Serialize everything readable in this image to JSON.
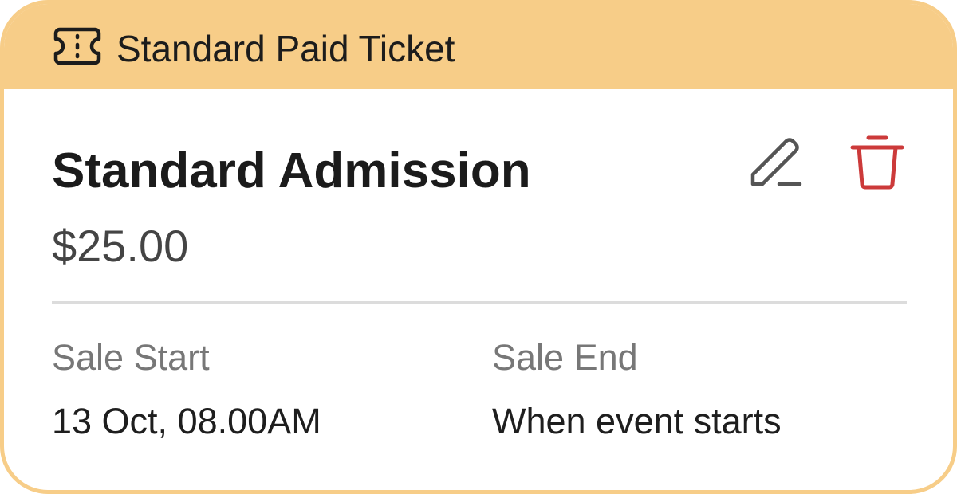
{
  "header": {
    "icon": "ticket-icon",
    "title": "Standard Paid Ticket"
  },
  "ticket": {
    "name": "Standard Admission",
    "price": "$25.00"
  },
  "actions": {
    "edit_icon": "pencil-icon",
    "delete_icon": "trash-icon"
  },
  "sale": {
    "start_label": "Sale Start",
    "start_value": "13 Oct, 08.00AM",
    "end_label": "Sale End",
    "end_value": "When event starts"
  },
  "colors": {
    "header_background": "#f7cd88",
    "delete_accent": "#cc3a3a",
    "edit_icon": "#555555"
  }
}
